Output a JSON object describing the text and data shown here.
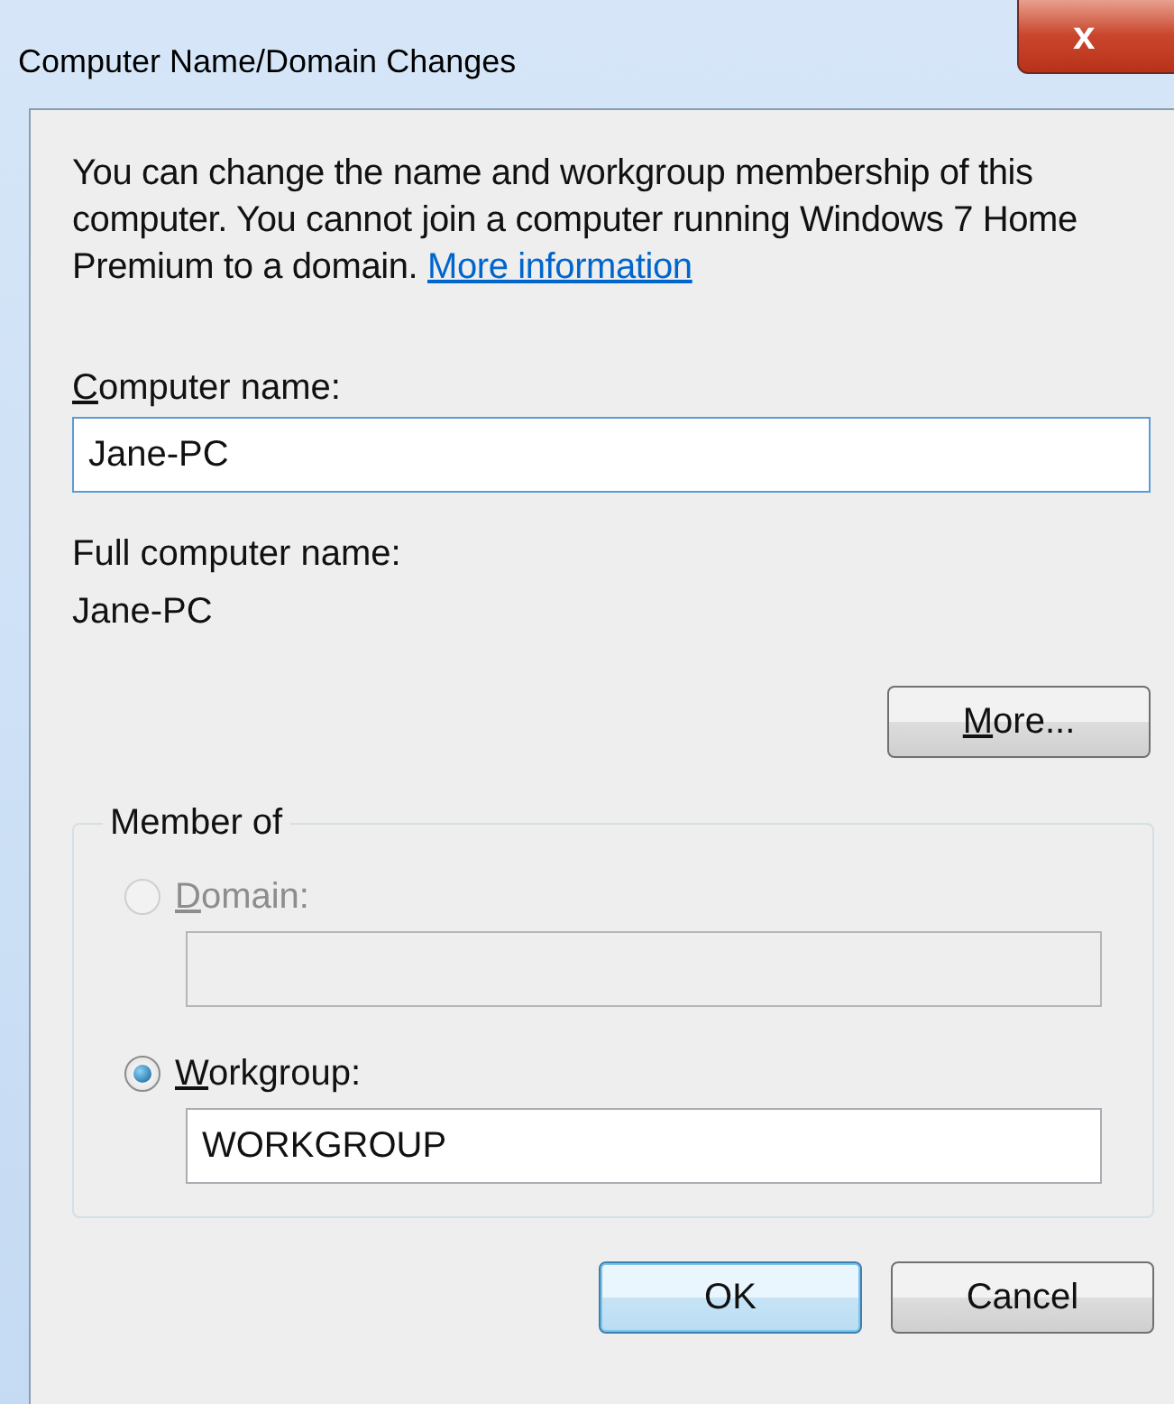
{
  "window": {
    "title": "Computer Name/Domain Changes",
    "close_glyph": "x"
  },
  "intro": {
    "text": "You can change the name and workgroup membership of this computer. You cannot join a computer running Windows 7 Home Premium to a domain.",
    "link": "More information"
  },
  "computer_name": {
    "label": "Computer name:",
    "underline_first": true,
    "value": "Jane-PC",
    "focused": true
  },
  "full_name": {
    "label": "Full computer name:",
    "value": "Jane-PC"
  },
  "more_button": {
    "label": "More...",
    "underline_first": true
  },
  "member_of": {
    "legend": "Member of",
    "options": [
      {
        "label": "Domain:",
        "underline_first": true,
        "selected": false,
        "disabled": true
      },
      {
        "label": "Workgroup:",
        "underline_first": true,
        "selected": true,
        "disabled": false,
        "value": "WORKGROUP"
      }
    ]
  },
  "buttons": [
    {
      "label": "OK",
      "default": true
    },
    {
      "label": "Cancel",
      "default": false
    }
  ]
}
